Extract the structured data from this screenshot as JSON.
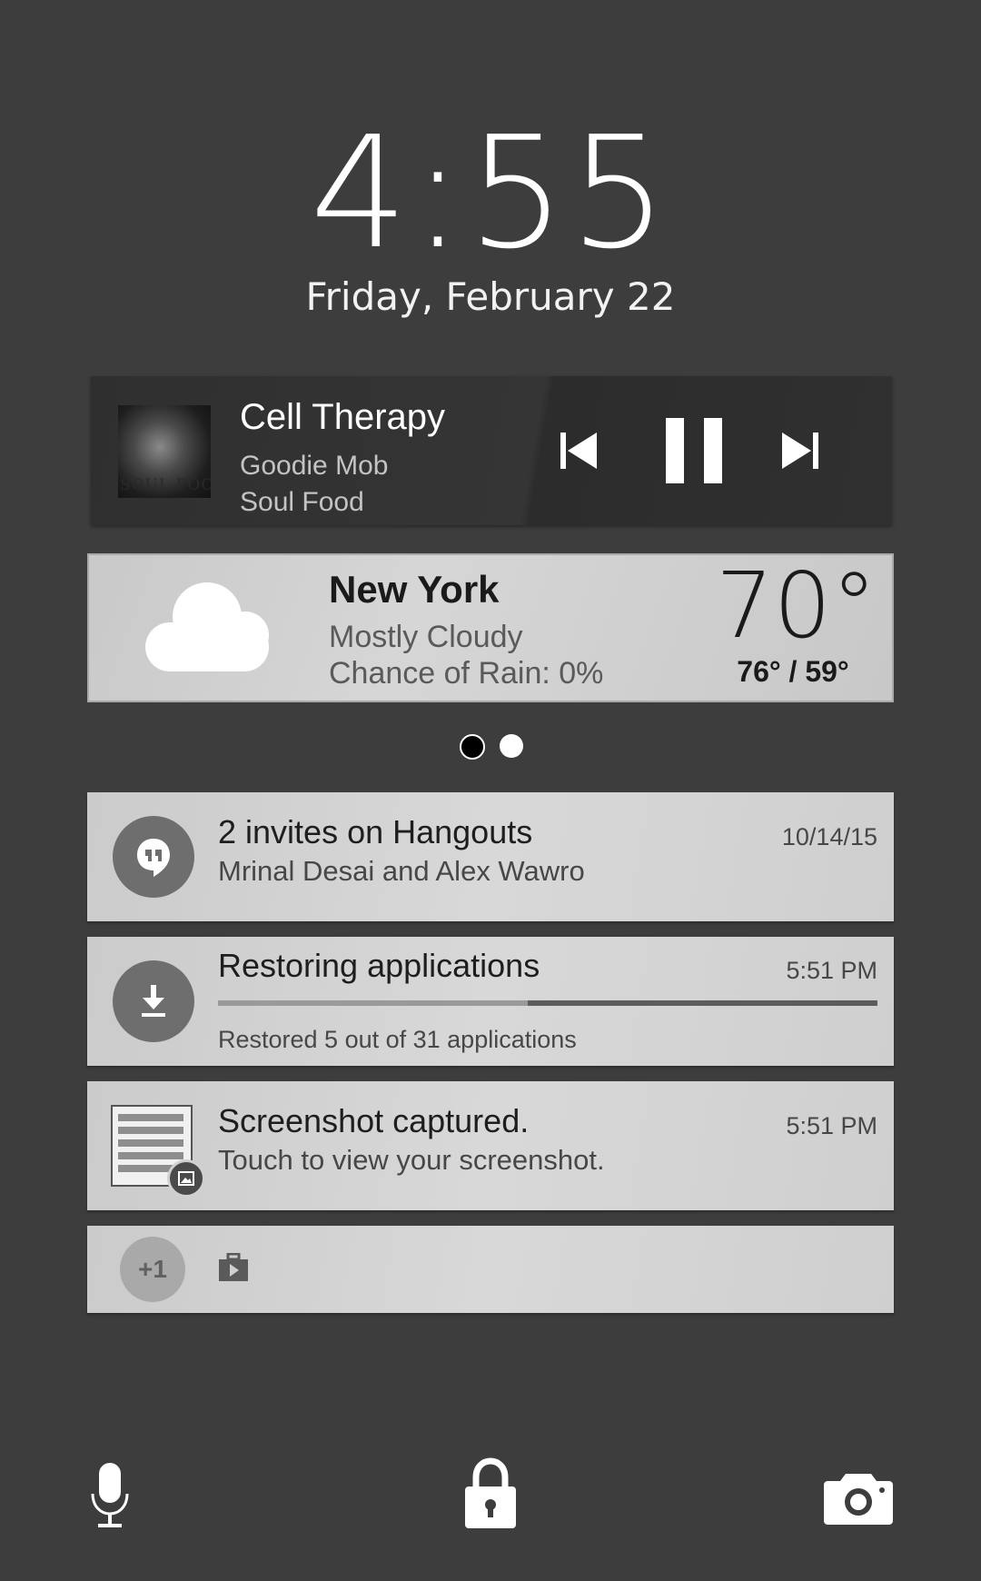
{
  "lockscreen": {
    "time": "4:55",
    "date": "Friday, February 22"
  },
  "music": {
    "song": "Cell Therapy",
    "artist": "Goodie Mob",
    "album": "Soul Food",
    "album_art_text": "SOUL FOOD",
    "controls": [
      "skip-previous-icon",
      "pause-icon",
      "skip-next-icon"
    ]
  },
  "weather": {
    "city": "New York",
    "condition": "Mostly Cloudy",
    "rain": "Chance of Rain: 0%",
    "temp": "70°",
    "hilo": "76° / 59°",
    "icon": "cloud-icon"
  },
  "pager": {
    "pages": 2,
    "active": 0
  },
  "notifications": [
    {
      "icon": "hangouts-icon",
      "title": "2 invites on Hangouts",
      "subtitle": "Mrinal Desai and Alex Wawro",
      "time": "10/14/15"
    },
    {
      "icon": "download-icon",
      "title": "Restoring applications",
      "subtitle": "Restored 5 out of 31 applications",
      "time": "5:51 PM",
      "progress": 0.47
    },
    {
      "icon": "screenshot-thumbnail",
      "title": "Screenshot captured.",
      "subtitle": "Touch to view your screenshot.",
      "time": "5:51 PM"
    },
    {
      "overflow_count": "+1",
      "icon": "briefcase-icon"
    }
  ],
  "bottom_bar": [
    "microphone-icon",
    "lock-icon",
    "camera-icon"
  ],
  "colors": {
    "background": "#3d3d3d",
    "card": "#d0d0d0"
  }
}
